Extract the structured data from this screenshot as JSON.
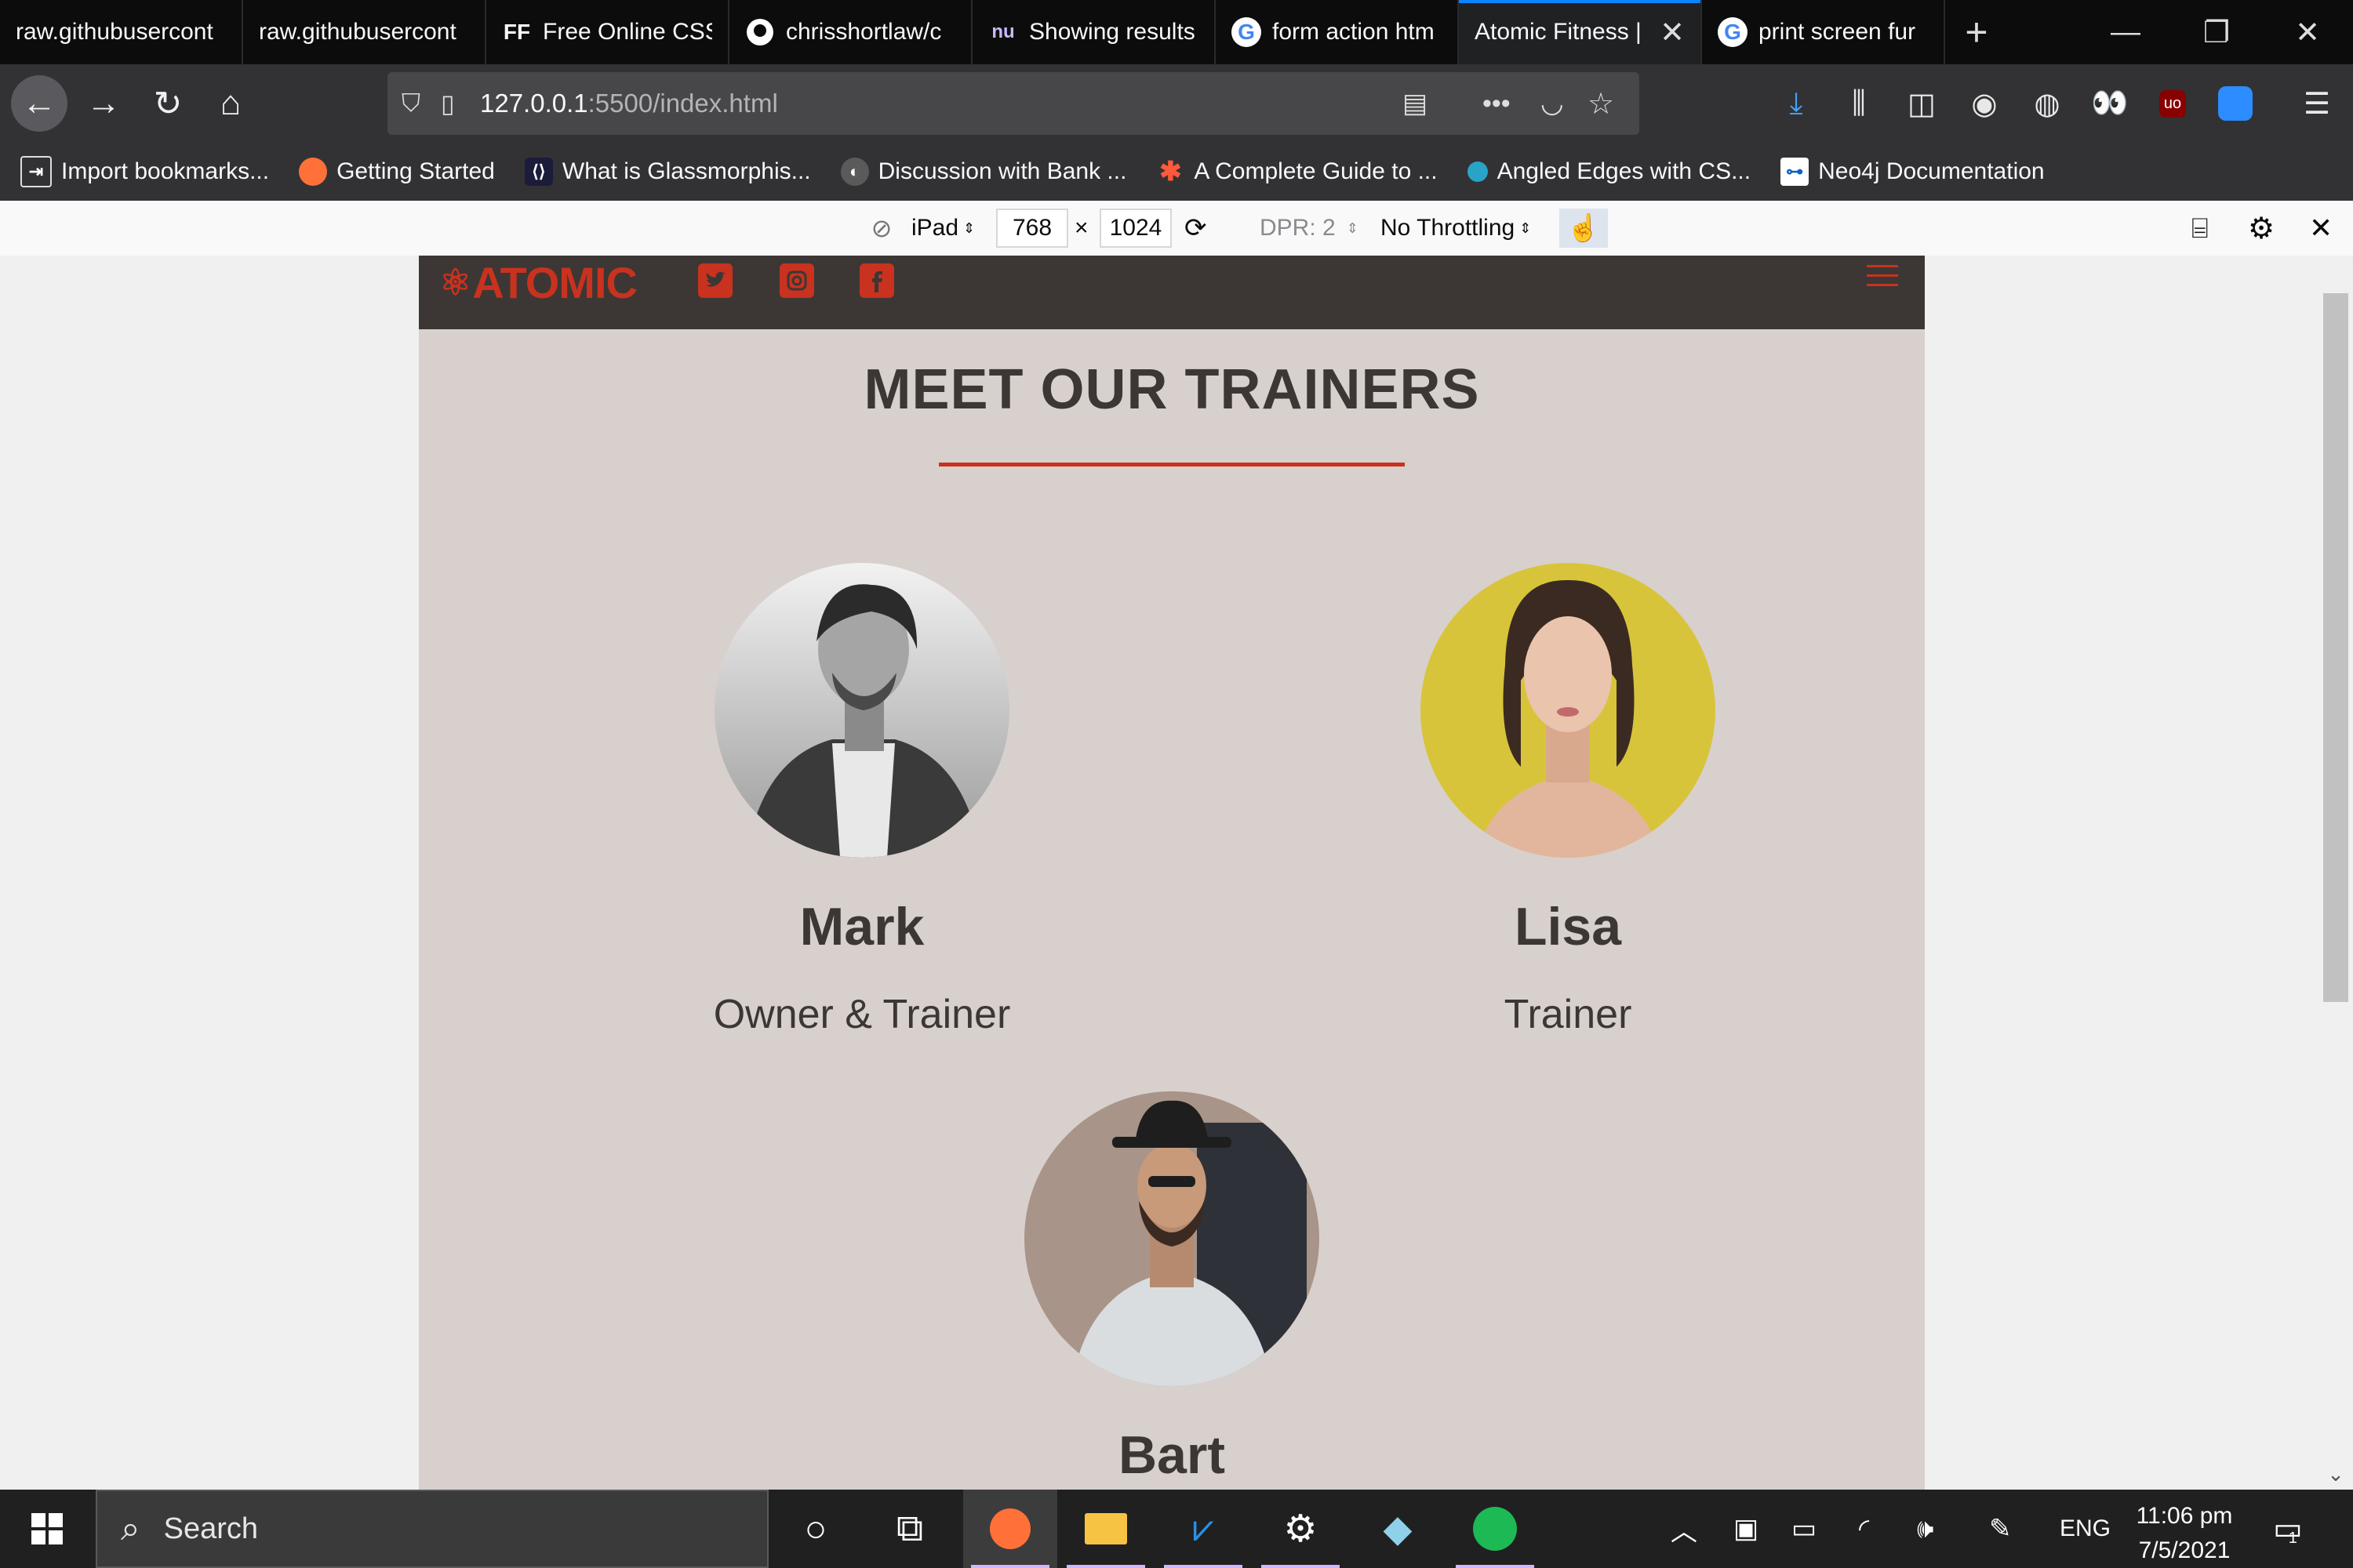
{
  "browser": {
    "tabs": [
      {
        "title": "raw.githubusercont",
        "icon": "page-icon",
        "active": false
      },
      {
        "title": "raw.githubusercont",
        "icon": "page-icon",
        "active": false
      },
      {
        "title": "Free Online CSS",
        "icon": "ff-icon",
        "icon_text": "FF",
        "active": false
      },
      {
        "title": "chrisshortlaw/c",
        "icon": "github-icon",
        "active": false
      },
      {
        "title": "Showing results",
        "icon": "nu-icon",
        "icon_text": "nu",
        "active": false
      },
      {
        "title": "form action htm",
        "icon": "google-icon",
        "icon_text": "G",
        "active": false
      },
      {
        "title": "Atomic Fitness |",
        "icon": "none",
        "active": true
      },
      {
        "title": "print screen fur",
        "icon": "google-icon",
        "icon_text": "G",
        "active": false
      }
    ],
    "url_host": "127.0.0.1",
    "url_path": ":5500/index.html",
    "bookmarks": [
      {
        "label": "Import bookmarks...",
        "icon": "import-icon",
        "color": "#323234"
      },
      {
        "label": "Getting Started",
        "icon": "firefox-icon",
        "color": "#ff7139"
      },
      {
        "label": "What is Glassmorphis...",
        "icon": "code-icon",
        "color": "#1b1b3a"
      },
      {
        "label": "Discussion with Bank ...",
        "icon": "globe-icon",
        "color": "#5a5a5a"
      },
      {
        "label": "A Complete Guide to ...",
        "icon": "asterisk-icon",
        "color": "#323234"
      },
      {
        "label": "Angled Edges with CS...",
        "icon": "dot-icon",
        "color": "#29a3c8"
      },
      {
        "label": "Neo4j Documentation",
        "icon": "neo4j-icon",
        "color": "#ffffff"
      }
    ]
  },
  "responsive_toolbar": {
    "device": "iPad",
    "width": "768",
    "height": "1024",
    "times": "×",
    "dpr": "DPR: 2",
    "throttling": "No Throttling"
  },
  "site": {
    "logo": "ATOMIC",
    "heading": "MEET OUR TRAINERS",
    "accent": "#c8321e",
    "trainers": [
      {
        "name": "Mark",
        "role": "Owner & Trainer"
      },
      {
        "name": "Lisa",
        "role": "Trainer"
      },
      {
        "name": "Bart",
        "role": ""
      }
    ]
  },
  "taskbar": {
    "search_placeholder": "Search",
    "language": "ENG",
    "time": "11:06 pm",
    "date": "7/5/2021",
    "notification_count": "1"
  }
}
